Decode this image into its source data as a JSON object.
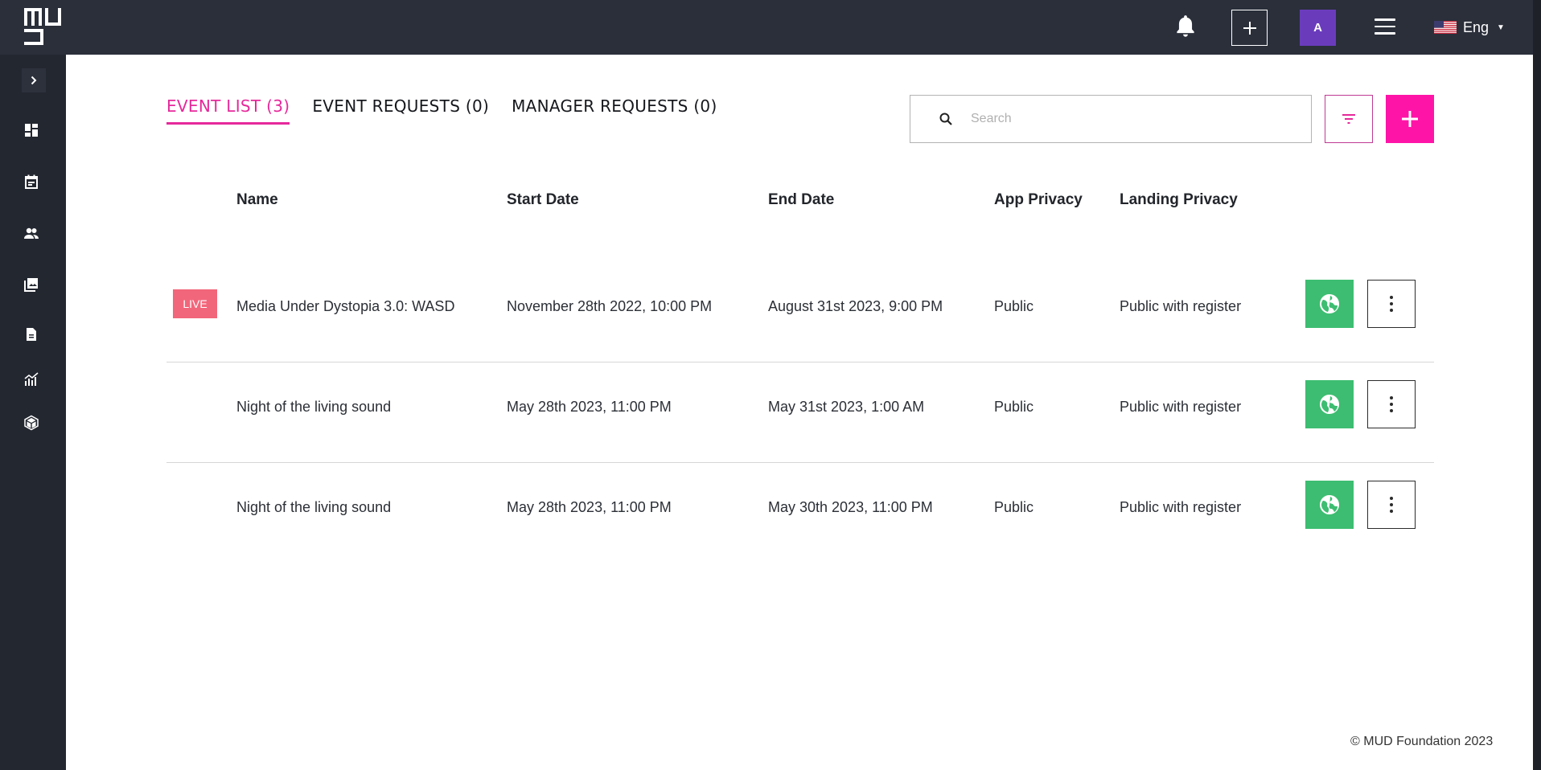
{
  "app": {
    "logo_text": "MUD",
    "accent_color": "#e6299b",
    "add_color": "#ff14a8",
    "live_color": "#f2667b",
    "globe_color": "#3dbd71",
    "avatar_color": "#6a3cbc"
  },
  "topbar": {
    "bell_icon": "bell-icon",
    "add_icon": "plus-icon",
    "avatar_initial": "A",
    "menu_icon": "hamburger-icon",
    "language": "Eng",
    "flag": "us-flag-icon"
  },
  "sidebar": {
    "toggle_icon": "chevron-right-icon",
    "items": [
      {
        "icon": "dashboard-icon"
      },
      {
        "icon": "calendar-icon"
      },
      {
        "icon": "users-icon"
      },
      {
        "icon": "gallery-icon"
      },
      {
        "icon": "document-icon"
      },
      {
        "icon": "analytics-icon"
      },
      {
        "icon": "cube-icon"
      }
    ]
  },
  "tabs": [
    {
      "label": "EVENT LIST (3)",
      "active": true
    },
    {
      "label": "EVENT REQUESTS (0)",
      "active": false
    },
    {
      "label": "MANAGER REQUESTS (0)",
      "active": false
    }
  ],
  "search": {
    "placeholder": "Search",
    "value": ""
  },
  "table": {
    "columns": [
      "Name",
      "Start Date",
      "End Date",
      "App Privacy",
      "Landing Privacy"
    ],
    "rows": [
      {
        "badge": "LIVE",
        "name": "Media Under Dystopia 3.0: WASD",
        "start": "November 28th 2022, 10:00 PM",
        "end": "August 31st 2023, 9:00 PM",
        "app_privacy": "Public",
        "landing_privacy": "Public with register"
      },
      {
        "badge": "",
        "name": "Night of the living sound",
        "start": "May 28th 2023, 11:00 PM",
        "end": "May 31st 2023, 1:00 AM",
        "app_privacy": "Public",
        "landing_privacy": "Public with register"
      },
      {
        "badge": "",
        "name": "Night of the living sound",
        "start": "May 28th 2023, 11:00 PM",
        "end": "May 30th 2023, 11:00 PM",
        "app_privacy": "Public",
        "landing_privacy": "Public with register"
      }
    ]
  },
  "footer": {
    "copyright": "© MUD Foundation 2023"
  }
}
